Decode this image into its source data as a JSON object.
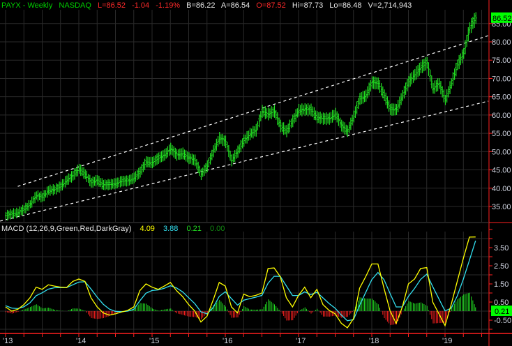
{
  "header": {
    "symbol": "PAYX - Weekly",
    "exchange": "NASDAQ",
    "last": "L=86.52",
    "change": "-1.04",
    "change_pct": "-1.19%",
    "bid": "B=86.22",
    "ask": "A=86.54",
    "open": "O=87.52",
    "high": "Hi=87.73",
    "low": "Lo=86.48",
    "volume": "V=2,714,943"
  },
  "macd_header": {
    "label": "MACD (12,26,9,Green,Red,DarkGray)",
    "macd": "4.09",
    "signal": "3.88",
    "histogram": "0.21",
    "extra": "0.00"
  },
  "colors": {
    "bars": "#22e022",
    "macd_line": "#ffff00",
    "signal_line": "#33e0f0",
    "hist_pos": "#22e022",
    "hist_neg": "#ff2020",
    "axis": "#ff2020",
    "grid": "#2a2a2a",
    "badge": "#00ff00"
  },
  "chart_data": [
    {
      "type": "line",
      "title": "PAYX - Weekly",
      "period": "monthly samples of weekly bars, Jan 2013 - Jun 2019",
      "ylim": [
        30,
        90
      ],
      "y_ticks": [
        "35.00",
        "40.00",
        "45.00",
        "50.00",
        "55.00",
        "60.00",
        "65.00",
        "70.00",
        "75.00",
        "80.00",
        "85.00"
      ],
      "x_ticks": [
        "'13",
        "'14",
        "'15",
        "'16",
        "'17",
        "'18",
        "'19"
      ],
      "last_price_badge": "86.52",
      "close": [
        32.5,
        33,
        33.3,
        34.2,
        35.6,
        38,
        37.5,
        39.4,
        39.6,
        40.5,
        42.2,
        43.4,
        45.3,
        43.8,
        41.5,
        42.2,
        40.9,
        41,
        41.3,
        41.9,
        42,
        42.8,
        44.4,
        47.2,
        47,
        48.2,
        49.1,
        50.8,
        49.1,
        49.5,
        48.2,
        47.6,
        43.8,
        46,
        50.1,
        53.7,
        52.7,
        47.6,
        50,
        53,
        54.8,
        55.8,
        61,
        60.3,
        61,
        57,
        55.6,
        58.4,
        61.3,
        61.5,
        61.4,
        59.4,
        59,
        59,
        60.3,
        57.1,
        55.6,
        59.6,
        64.4,
        65.3,
        68.9,
        68.6,
        65.4,
        61.5,
        61.5,
        65.3,
        69.1,
        71,
        73,
        74.3,
        67.3,
        68.6,
        64.1,
        68.6,
        73.7,
        76.8,
        83.8,
        86.52
      ],
      "trendlines": [
        {
          "name": "upper channel",
          "from": [
            2,
            40.5
          ],
          "to": [
            79.1,
            81.7
          ]
        },
        {
          "name": "lower channel",
          "from": [
            -0.9,
            31
          ],
          "to": [
            79.1,
            63.8
          ]
        }
      ]
    },
    {
      "type": "line",
      "title": "MACD (12,26,9)",
      "ylim": [
        -1.25,
        4.7
      ],
      "y_ticks": [
        "3.50",
        "2.50",
        "1.50",
        "0.50",
        "-0.50"
      ],
      "histogram_badge": "0.21",
      "series": [
        {
          "name": "MACD",
          "values": [
            0.23,
            0,
            0.1,
            0.36,
            0.74,
            1.32,
            1.2,
            1.45,
            1.38,
            1.32,
            1.3,
            1.64,
            1.77,
            1.64,
            0.74,
            0.23,
            -0.1,
            -0.22,
            -0.15,
            -0.05,
            0.04,
            0.23,
            1.13,
            1.5,
            1.32,
            1.2,
            1.38,
            1.58,
            1.13,
            0.8,
            0.36,
            0,
            -0.6,
            -0.28,
            0.6,
            1.58,
            1.38,
            0.23,
            -0.1,
            0.94,
            0.8,
            0.87,
            1,
            2.35,
            2.38,
            1.9,
            0.74,
            0.23,
            0.87,
            1.32,
            0.74,
            1.2,
            0.36,
            0.04,
            -0.15,
            -0.67,
            -0.92,
            -0.41,
            1.26,
            1.9,
            2.6,
            2.6,
            1.26,
            0,
            -0.67,
            0.23,
            1.5,
            1.77,
            2.35,
            2.4,
            0.49,
            -0.15,
            -0.8,
            0.36,
            1.64,
            2.92,
            4.08,
            4.09
          ]
        },
        {
          "name": "Signal",
          "values": [
            0.3,
            0.17,
            0.14,
            0.24,
            0.46,
            0.85,
            1.01,
            1.21,
            1.29,
            1.3,
            1.3,
            1.45,
            1.6,
            1.62,
            1.22,
            0.77,
            0.38,
            0.11,
            -0.01,
            -0.03,
            0,
            0.1,
            0.57,
            0.99,
            1.14,
            1.17,
            1.26,
            1.4,
            1.28,
            1.06,
            0.74,
            0.41,
            -0.04,
            -0.15,
            0.19,
            0.81,
            1.07,
            0.69,
            0.33,
            0.6,
            0.69,
            0.77,
            0.87,
            1.54,
            1.92,
            1.92,
            1.39,
            0.86,
            0.86,
            1.06,
            0.91,
            1.04,
            0.73,
            0.42,
            0.16,
            -0.21,
            -0.53,
            -0.47,
            0.31,
            1.03,
            1.74,
            2.13,
            1.74,
            0.96,
            0.23,
            0.23,
            0.81,
            1.25,
            1.75,
            2.04,
            1.34,
            0.67,
            0.01,
            0.16,
            0.83,
            1.77,
            2.81,
            3.88
          ]
        }
      ]
    }
  ]
}
